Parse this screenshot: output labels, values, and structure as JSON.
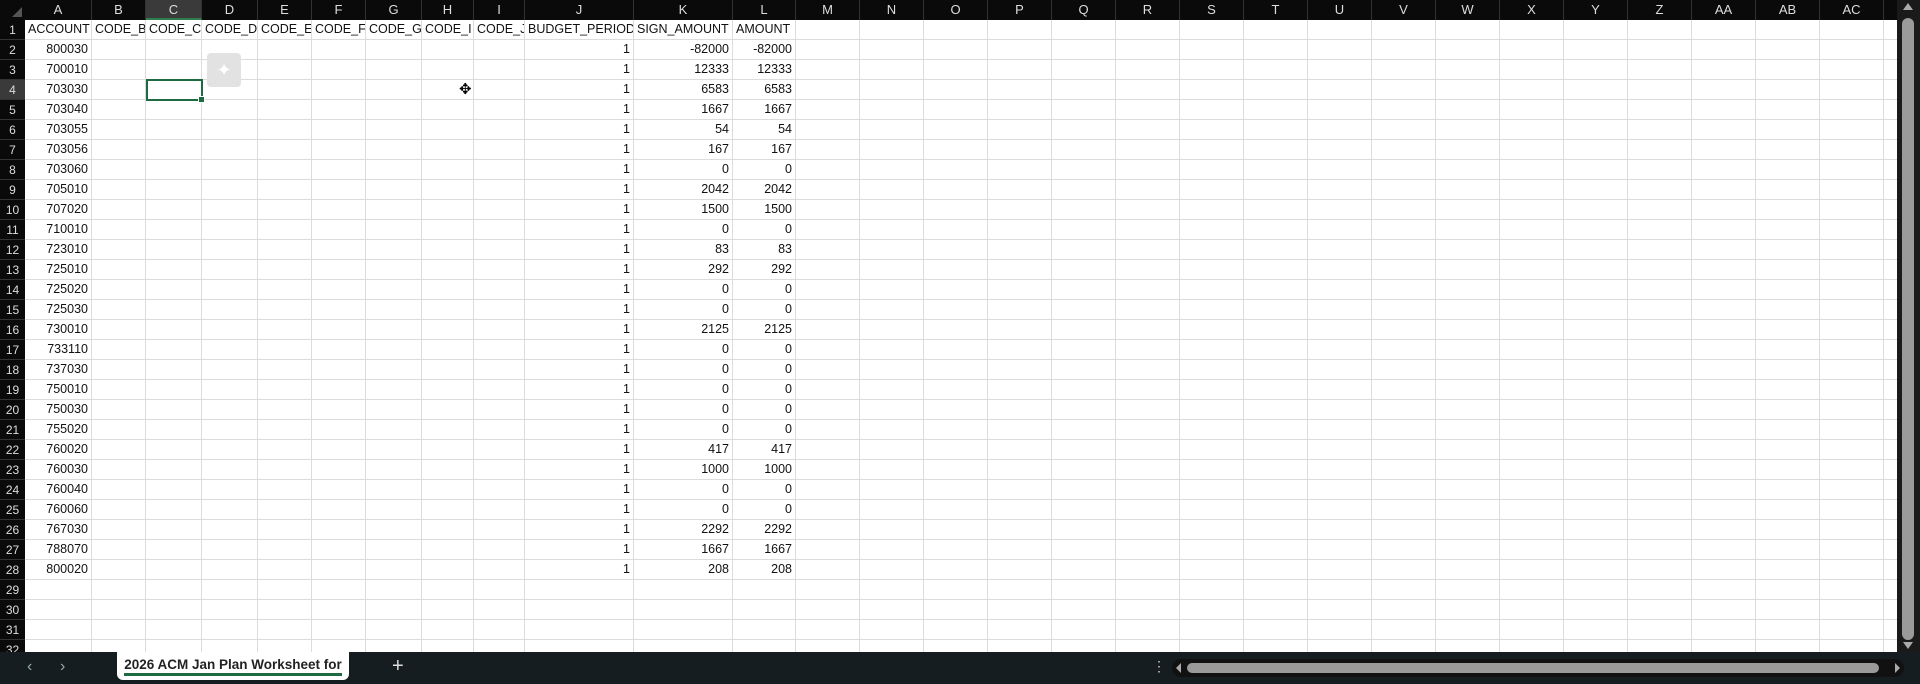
{
  "columns": [
    "A",
    "B",
    "C",
    "D",
    "E",
    "F",
    "G",
    "H",
    "I",
    "J",
    "K",
    "L",
    "M",
    "N",
    "O",
    "P",
    "Q",
    "R",
    "S",
    "T",
    "U",
    "V",
    "W",
    "X",
    "Y",
    "Z",
    "AA",
    "AB",
    "AC"
  ],
  "selected_cell": {
    "column": "C",
    "row": 4
  },
  "headers": [
    "ACCOUNT",
    "CODE_B",
    "CODE_C",
    "CODE_D",
    "CODE_E",
    "CODE_F",
    "CODE_G",
    "CODE_I",
    "CODE_J",
    "BUDGET_PERIOD",
    "SIGN_AMOUNT",
    "AMOUNT"
  ],
  "rows": [
    [
      "800030",
      "",
      "",
      "",
      "",
      "",
      "",
      "",
      "",
      "1",
      "-82000",
      "-82000"
    ],
    [
      "700010",
      "",
      "",
      "",
      "",
      "",
      "",
      "",
      "",
      "1",
      "12333",
      "12333"
    ],
    [
      "703030",
      "",
      "",
      "",
      "",
      "",
      "",
      "",
      "",
      "1",
      "6583",
      "6583"
    ],
    [
      "703040",
      "",
      "",
      "",
      "",
      "",
      "",
      "",
      "",
      "1",
      "1667",
      "1667"
    ],
    [
      "703055",
      "",
      "",
      "",
      "",
      "",
      "",
      "",
      "",
      "1",
      "54",
      "54"
    ],
    [
      "703056",
      "",
      "",
      "",
      "",
      "",
      "",
      "",
      "",
      "1",
      "167",
      "167"
    ],
    [
      "703060",
      "",
      "",
      "",
      "",
      "",
      "",
      "",
      "",
      "1",
      "0",
      "0"
    ],
    [
      "705010",
      "",
      "",
      "",
      "",
      "",
      "",
      "",
      "",
      "1",
      "2042",
      "2042"
    ],
    [
      "707020",
      "",
      "",
      "",
      "",
      "",
      "",
      "",
      "",
      "1",
      "1500",
      "1500"
    ],
    [
      "710010",
      "",
      "",
      "",
      "",
      "",
      "",
      "",
      "",
      "1",
      "0",
      "0"
    ],
    [
      "723010",
      "",
      "",
      "",
      "",
      "",
      "",
      "",
      "",
      "1",
      "83",
      "83"
    ],
    [
      "725010",
      "",
      "",
      "",
      "",
      "",
      "",
      "",
      "",
      "1",
      "292",
      "292"
    ],
    [
      "725020",
      "",
      "",
      "",
      "",
      "",
      "",
      "",
      "",
      "1",
      "0",
      "0"
    ],
    [
      "725030",
      "",
      "",
      "",
      "",
      "",
      "",
      "",
      "",
      "1",
      "0",
      "0"
    ],
    [
      "730010",
      "",
      "",
      "",
      "",
      "",
      "",
      "",
      "",
      "1",
      "2125",
      "2125"
    ],
    [
      "733110",
      "",
      "",
      "",
      "",
      "",
      "",
      "",
      "",
      "1",
      "0",
      "0"
    ],
    [
      "737030",
      "",
      "",
      "",
      "",
      "",
      "",
      "",
      "",
      "1",
      "0",
      "0"
    ],
    [
      "750010",
      "",
      "",
      "",
      "",
      "",
      "",
      "",
      "",
      "1",
      "0",
      "0"
    ],
    [
      "750030",
      "",
      "",
      "",
      "",
      "",
      "",
      "",
      "",
      "1",
      "0",
      "0"
    ],
    [
      "755020",
      "",
      "",
      "",
      "",
      "",
      "",
      "",
      "",
      "1",
      "0",
      "0"
    ],
    [
      "760020",
      "",
      "",
      "",
      "",
      "",
      "",
      "",
      "",
      "1",
      "417",
      "417"
    ],
    [
      "760030",
      "",
      "",
      "",
      "",
      "",
      "",
      "",
      "",
      "1",
      "1000",
      "1000"
    ],
    [
      "760040",
      "",
      "",
      "",
      "",
      "",
      "",
      "",
      "",
      "1",
      "0",
      "0"
    ],
    [
      "760060",
      "",
      "",
      "",
      "",
      "",
      "",
      "",
      "",
      "1",
      "0",
      "0"
    ],
    [
      "767030",
      "",
      "",
      "",
      "",
      "",
      "",
      "",
      "",
      "1",
      "2292",
      "2292"
    ],
    [
      "788070",
      "",
      "",
      "",
      "",
      "",
      "",
      "",
      "",
      "1",
      "1667",
      "1667"
    ],
    [
      "800020",
      "",
      "",
      "",
      "",
      "",
      "",
      "",
      "",
      "1",
      "208",
      "208"
    ]
  ],
  "sheet_tab": "2026 ACM Jan Plan Worksheet for",
  "add_sheet": "+",
  "accent": "#1e6b41"
}
